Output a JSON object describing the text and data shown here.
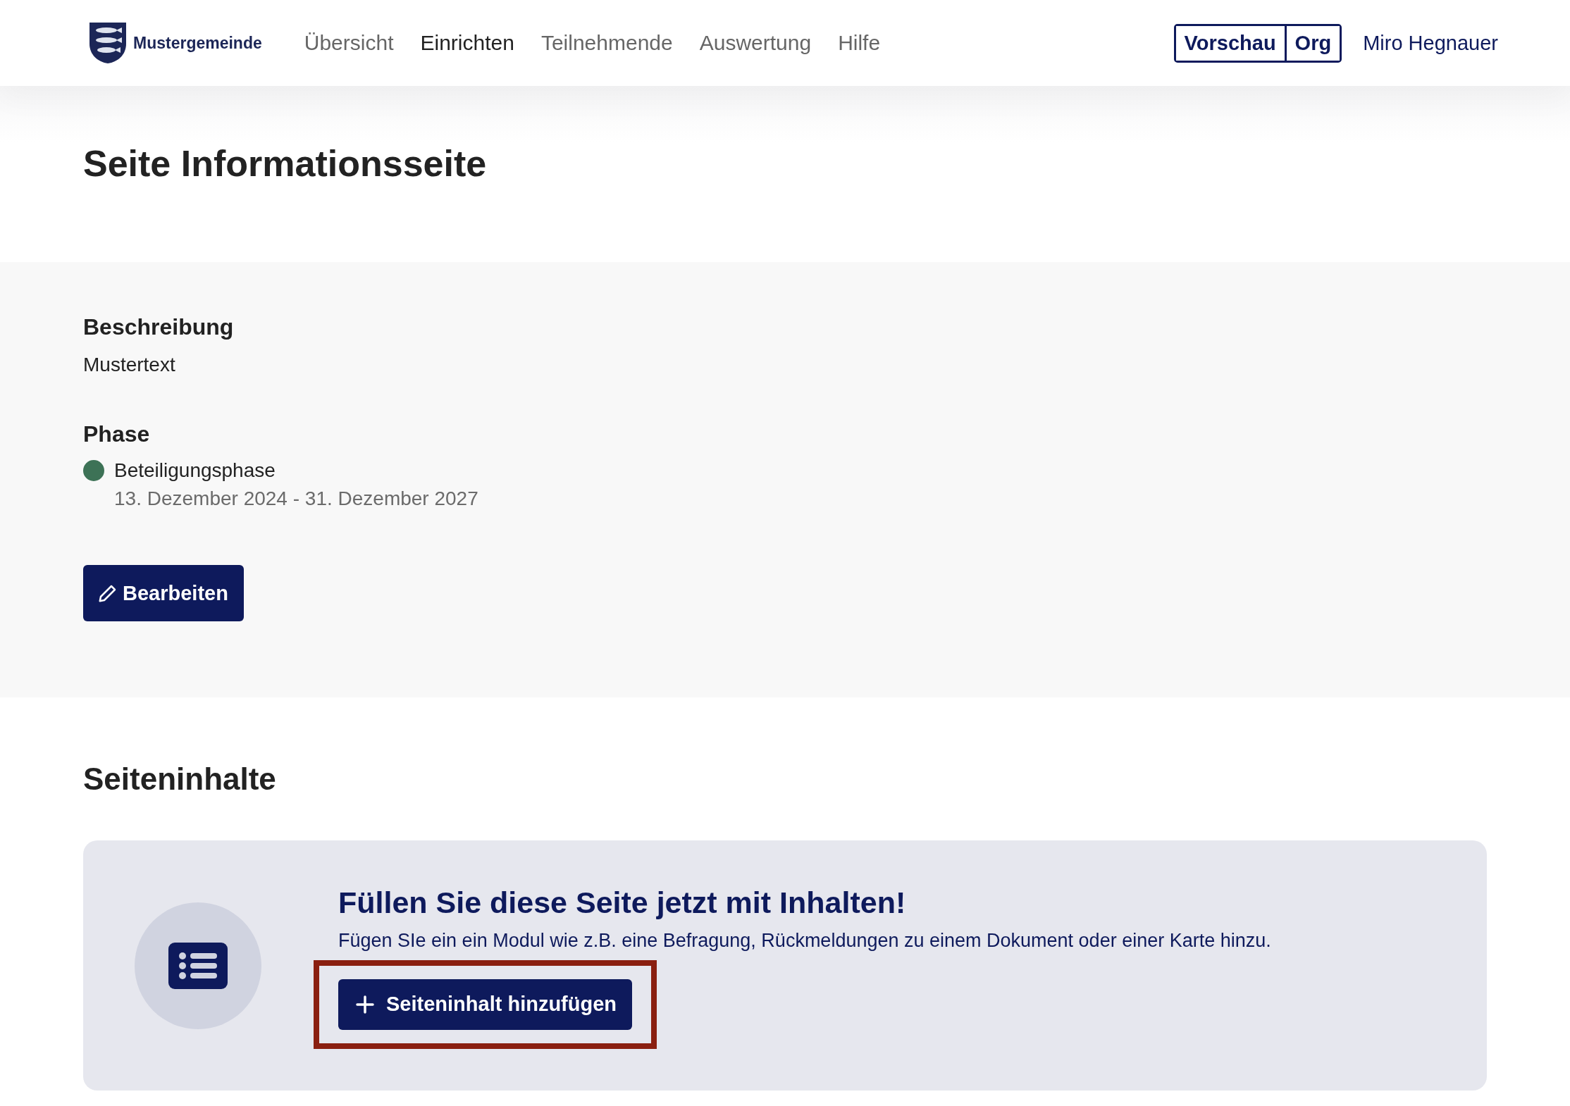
{
  "header": {
    "brand": "Mustergemeinde",
    "nav": [
      {
        "label": "Übersicht",
        "selected": false
      },
      {
        "label": "Einrichten",
        "selected": true
      },
      {
        "label": "Teilnehmende",
        "selected": false
      },
      {
        "label": "Auswertung",
        "selected": false
      },
      {
        "label": "Hilfe",
        "selected": false
      }
    ],
    "preview_buttons": [
      "Vorschau",
      "Org"
    ],
    "user": "Miro Hegnauer"
  },
  "page_title": "Seite Informationsseite",
  "info": {
    "description_heading": "Beschreibung",
    "description": "Mustertext",
    "phase_heading": "Phase",
    "phase": {
      "name": "Beteiligungsphase",
      "color": "#3d7256",
      "dates": "13. Dezember 2024 - 31. Dezember 2027"
    },
    "edit_button": "Bearbeiten"
  },
  "contents": {
    "heading": "Seiteninhalte",
    "empty_state": {
      "title": "Füllen Sie diese Seite jetzt mit Inhalten!",
      "text": "Fügen SIe ein ein Modul wie z.B. eine Befragung, Rückmeldungen zu einem Dokument oder einer Karte hinzu.",
      "button": "Seiteninhalt hinzufügen",
      "highlighted": true
    }
  }
}
